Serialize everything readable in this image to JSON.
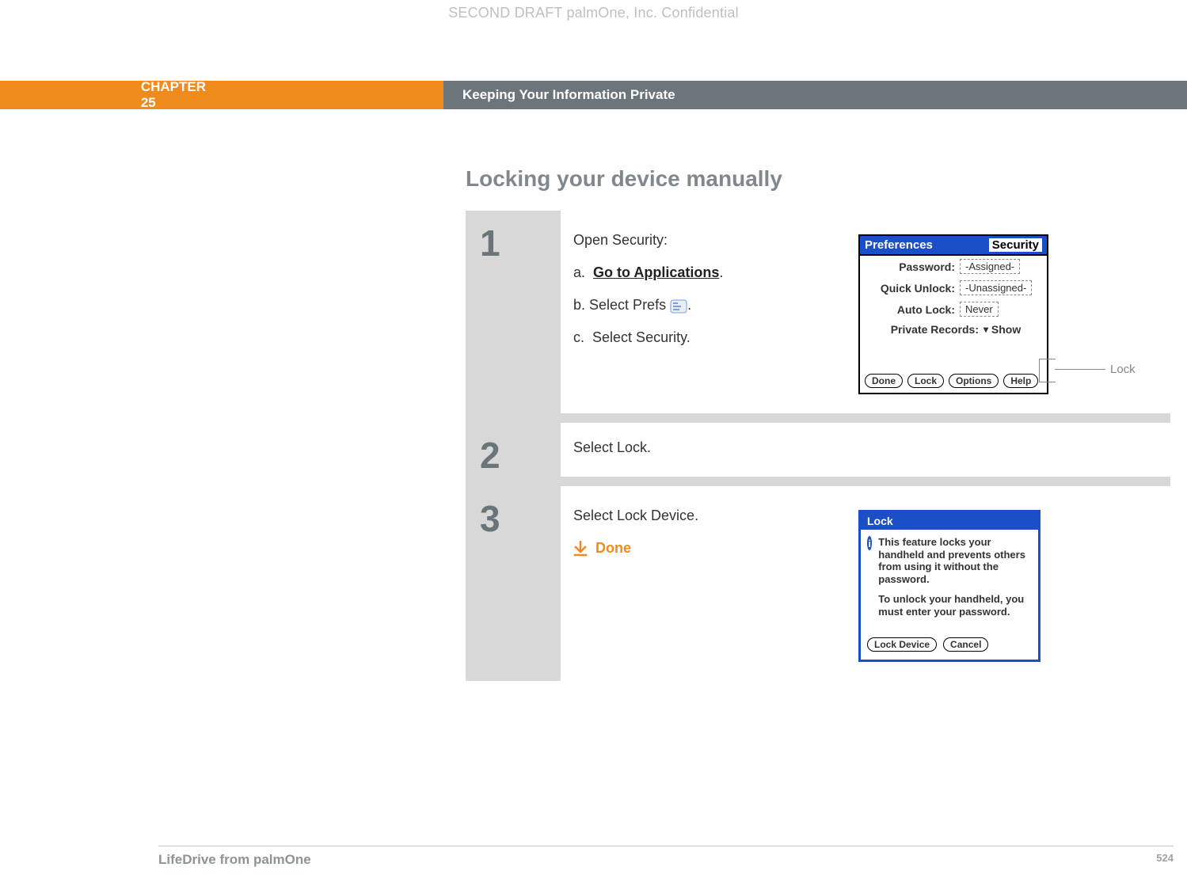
{
  "watermark": "SECOND DRAFT palmOne, Inc.  Confidential",
  "header": {
    "chapter": "CHAPTER 25",
    "title": "Keeping Your Information Private"
  },
  "section_title": "Locking your device manually",
  "steps": {
    "s1": {
      "num": "1",
      "lead": "Open Security:",
      "a_prefix": "a.",
      "a_text": "Go to Applications",
      "a_suffix": ".",
      "b_prefix": "b.",
      "b_text_before": "Select Prefs ",
      "b_text_after": ".",
      "c_prefix": "c.",
      "c_text": "Select Security."
    },
    "s2": {
      "num": "2",
      "text": "Select Lock."
    },
    "s3": {
      "num": "3",
      "text": "Select Lock Device.",
      "done": "Done"
    }
  },
  "palm_prefs": {
    "title": "Preferences",
    "subtitle": "Security",
    "rows": {
      "password_label": "Password:",
      "password_value": "-Assigned-",
      "quick_label": "Quick Unlock:",
      "quick_value": "-Unassigned-",
      "auto_label": "Auto Lock:",
      "auto_value": "Never",
      "private_label": "Private Records:",
      "private_value": "Show"
    },
    "buttons": {
      "done": "Done",
      "lock": "Lock",
      "options": "Options",
      "help": "Help"
    },
    "callout": "Lock"
  },
  "palm_lock": {
    "title": "Lock",
    "p1": "This feature locks your handheld and prevents others from using it without the password.",
    "p2": "To unlock your handheld, you must enter your password.",
    "buttons": {
      "lock_device": "Lock Device",
      "cancel": "Cancel"
    }
  },
  "footer": {
    "product": "LifeDrive from palmOne",
    "page": "524"
  }
}
